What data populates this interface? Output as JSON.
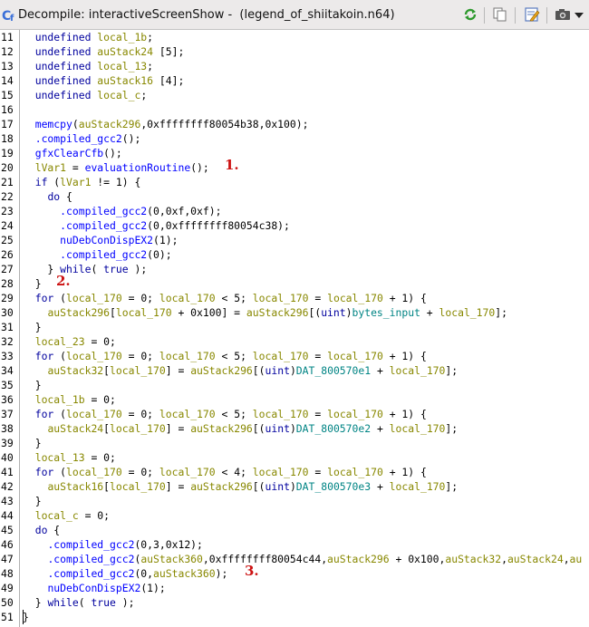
{
  "window": {
    "title": "Decompile: interactiveScreenShow -  (legend_of_shiitakoin.n64)",
    "toolbar": [
      "refresh-icon",
      "copy-icon",
      "edit-snapshot-icon",
      "camera-icon",
      "menu-dropdown-icon"
    ]
  },
  "code": {
    "first_line": 11,
    "lines": [
      [
        [
          "  undefined ",
          "ty"
        ],
        [
          "local_1b",
          "var"
        ],
        [
          ";",
          ""
        ]
      ],
      [
        [
          "  undefined ",
          "ty"
        ],
        [
          "auStack24",
          "var"
        ],
        [
          " [5];",
          ""
        ]
      ],
      [
        [
          "  undefined ",
          "ty"
        ],
        [
          "local_13",
          "var"
        ],
        [
          ";",
          ""
        ]
      ],
      [
        [
          "  undefined ",
          "ty"
        ],
        [
          "auStack16",
          "var"
        ],
        [
          " [4];",
          ""
        ]
      ],
      [
        [
          "  undefined ",
          "ty"
        ],
        [
          "local_c",
          "var"
        ],
        [
          ";",
          ""
        ]
      ],
      [
        [
          "",
          ""
        ]
      ],
      [
        [
          "  ",
          ""
        ],
        [
          "memcpy",
          "fn"
        ],
        [
          "(",
          ""
        ],
        [
          "auStack296",
          "var"
        ],
        [
          ",0xffffffff80054b38,0x100);",
          ""
        ]
      ],
      [
        [
          "  ",
          ""
        ],
        [
          ".compiled_gcc2",
          "fn"
        ],
        [
          "();",
          ""
        ]
      ],
      [
        [
          "  ",
          ""
        ],
        [
          "gfxClearCfb",
          "fn"
        ],
        [
          "();",
          ""
        ]
      ],
      [
        [
          "  ",
          ""
        ],
        [
          "lVar1",
          "var"
        ],
        [
          " = ",
          ""
        ],
        [
          "evaluationRoutine",
          "fn"
        ],
        [
          "();",
          ""
        ]
      ],
      [
        [
          "  ",
          ""
        ],
        [
          "if",
          "kw"
        ],
        [
          " (",
          ""
        ],
        [
          "lVar1",
          "var"
        ],
        [
          " != 1) {",
          ""
        ]
      ],
      [
        [
          "    ",
          ""
        ],
        [
          "do",
          "kw"
        ],
        [
          " {",
          ""
        ]
      ],
      [
        [
          "      ",
          ""
        ],
        [
          ".compiled_gcc2",
          "fn"
        ],
        [
          "(0,0xf,0xf);",
          ""
        ]
      ],
      [
        [
          "      ",
          ""
        ],
        [
          ".compiled_gcc2",
          "fn"
        ],
        [
          "(0,0xffffffff80054c38);",
          ""
        ]
      ],
      [
        [
          "      ",
          ""
        ],
        [
          "nuDebConDispEX2",
          "fn"
        ],
        [
          "(1);",
          ""
        ]
      ],
      [
        [
          "      ",
          ""
        ],
        [
          ".compiled_gcc2",
          "fn"
        ],
        [
          "(0);",
          ""
        ]
      ],
      [
        [
          "    } ",
          ""
        ],
        [
          "while",
          "kw"
        ],
        [
          "( ",
          ""
        ],
        [
          "true",
          "kw"
        ],
        [
          " );",
          ""
        ]
      ],
      [
        [
          "  }",
          ""
        ]
      ],
      [
        [
          "  ",
          ""
        ],
        [
          "for",
          "kw"
        ],
        [
          " (",
          ""
        ],
        [
          "local_170",
          "var"
        ],
        [
          " = 0; ",
          ""
        ],
        [
          "local_170",
          "var"
        ],
        [
          " < 5; ",
          ""
        ],
        [
          "local_170",
          "var"
        ],
        [
          " = ",
          ""
        ],
        [
          "local_170",
          "var"
        ],
        [
          " + 1) {",
          ""
        ]
      ],
      [
        [
          "    ",
          ""
        ],
        [
          "auStack296",
          "var"
        ],
        [
          "[",
          ""
        ],
        [
          "local_170",
          "var"
        ],
        [
          " + 0x100] = ",
          ""
        ],
        [
          "auStack296",
          "var"
        ],
        [
          "[(",
          ""
        ],
        [
          "uint",
          "ty"
        ],
        [
          ")",
          ""
        ],
        [
          "bytes_input",
          "glb"
        ],
        [
          " + ",
          ""
        ],
        [
          "local_170",
          "var"
        ],
        [
          "];",
          ""
        ]
      ],
      [
        [
          "  }",
          ""
        ]
      ],
      [
        [
          "  ",
          ""
        ],
        [
          "local_23",
          "var"
        ],
        [
          " = 0;",
          ""
        ]
      ],
      [
        [
          "  ",
          ""
        ],
        [
          "for",
          "kw"
        ],
        [
          " (",
          ""
        ],
        [
          "local_170",
          "var"
        ],
        [
          " = 0; ",
          ""
        ],
        [
          "local_170",
          "var"
        ],
        [
          " < 5; ",
          ""
        ],
        [
          "local_170",
          "var"
        ],
        [
          " = ",
          ""
        ],
        [
          "local_170",
          "var"
        ],
        [
          " + 1) {",
          ""
        ]
      ],
      [
        [
          "    ",
          ""
        ],
        [
          "auStack32",
          "var"
        ],
        [
          "[",
          ""
        ],
        [
          "local_170",
          "var"
        ],
        [
          "] = ",
          ""
        ],
        [
          "auStack296",
          "var"
        ],
        [
          "[(",
          ""
        ],
        [
          "uint",
          "ty"
        ],
        [
          ")",
          ""
        ],
        [
          "DAT_800570e1",
          "glb"
        ],
        [
          " + ",
          ""
        ],
        [
          "local_170",
          "var"
        ],
        [
          "];",
          ""
        ]
      ],
      [
        [
          "  }",
          ""
        ]
      ],
      [
        [
          "  ",
          ""
        ],
        [
          "local_1b",
          "var"
        ],
        [
          " = 0;",
          ""
        ]
      ],
      [
        [
          "  ",
          ""
        ],
        [
          "for",
          "kw"
        ],
        [
          " (",
          ""
        ],
        [
          "local_170",
          "var"
        ],
        [
          " = 0; ",
          ""
        ],
        [
          "local_170",
          "var"
        ],
        [
          " < 5; ",
          ""
        ],
        [
          "local_170",
          "var"
        ],
        [
          " = ",
          ""
        ],
        [
          "local_170",
          "var"
        ],
        [
          " + 1) {",
          ""
        ]
      ],
      [
        [
          "    ",
          ""
        ],
        [
          "auStack24",
          "var"
        ],
        [
          "[",
          ""
        ],
        [
          "local_170",
          "var"
        ],
        [
          "] = ",
          ""
        ],
        [
          "auStack296",
          "var"
        ],
        [
          "[(",
          ""
        ],
        [
          "uint",
          "ty"
        ],
        [
          ")",
          ""
        ],
        [
          "DAT_800570e2",
          "glb"
        ],
        [
          " + ",
          ""
        ],
        [
          "local_170",
          "var"
        ],
        [
          "];",
          ""
        ]
      ],
      [
        [
          "  }",
          ""
        ]
      ],
      [
        [
          "  ",
          ""
        ],
        [
          "local_13",
          "var"
        ],
        [
          " = 0;",
          ""
        ]
      ],
      [
        [
          "  ",
          ""
        ],
        [
          "for",
          "kw"
        ],
        [
          " (",
          ""
        ],
        [
          "local_170",
          "var"
        ],
        [
          " = 0; ",
          ""
        ],
        [
          "local_170",
          "var"
        ],
        [
          " < 4; ",
          ""
        ],
        [
          "local_170",
          "var"
        ],
        [
          " = ",
          ""
        ],
        [
          "local_170",
          "var"
        ],
        [
          " + 1) {",
          ""
        ]
      ],
      [
        [
          "    ",
          ""
        ],
        [
          "auStack16",
          "var"
        ],
        [
          "[",
          ""
        ],
        [
          "local_170",
          "var"
        ],
        [
          "] = ",
          ""
        ],
        [
          "auStack296",
          "var"
        ],
        [
          "[(",
          ""
        ],
        [
          "uint",
          "ty"
        ],
        [
          ")",
          ""
        ],
        [
          "DAT_800570e3",
          "glb"
        ],
        [
          " + ",
          ""
        ],
        [
          "local_170",
          "var"
        ],
        [
          "];",
          ""
        ]
      ],
      [
        [
          "  }",
          ""
        ]
      ],
      [
        [
          "  ",
          ""
        ],
        [
          "local_c",
          "var"
        ],
        [
          " = 0;",
          ""
        ]
      ],
      [
        [
          "  ",
          ""
        ],
        [
          "do",
          "kw"
        ],
        [
          " {",
          ""
        ]
      ],
      [
        [
          "    ",
          ""
        ],
        [
          ".compiled_gcc2",
          "fn"
        ],
        [
          "(0,3,0x12);",
          ""
        ]
      ],
      [
        [
          "    ",
          ""
        ],
        [
          ".compiled_gcc2",
          "fn"
        ],
        [
          "(",
          ""
        ],
        [
          "auStack360",
          "var"
        ],
        [
          ",0xffffffff80054c44,",
          ""
        ],
        [
          "auStack296",
          "var"
        ],
        [
          " + 0x100,",
          ""
        ],
        [
          "auStack32",
          "var"
        ],
        [
          ",",
          ""
        ],
        [
          "auStack24",
          "var"
        ],
        [
          ",",
          ""
        ],
        [
          "au",
          "var"
        ]
      ],
      [
        [
          "    ",
          ""
        ],
        [
          ".compiled_gcc2",
          "fn"
        ],
        [
          "(0,",
          ""
        ],
        [
          "auStack360",
          "var"
        ],
        [
          ");",
          ""
        ]
      ],
      [
        [
          "    ",
          ""
        ],
        [
          "nuDebConDispEX2",
          "fn"
        ],
        [
          "(1);",
          ""
        ]
      ],
      [
        [
          "  } ",
          ""
        ],
        [
          "while",
          "kw"
        ],
        [
          "( ",
          ""
        ],
        [
          "true",
          "kw"
        ],
        [
          " );",
          ""
        ]
      ],
      [
        [
          "}",
          ""
        ]
      ]
    ]
  },
  "annotations": [
    {
      "label": "1.",
      "line": 20
    },
    {
      "label": "2.",
      "line": 28
    },
    {
      "label": "3.",
      "line": 48
    }
  ]
}
